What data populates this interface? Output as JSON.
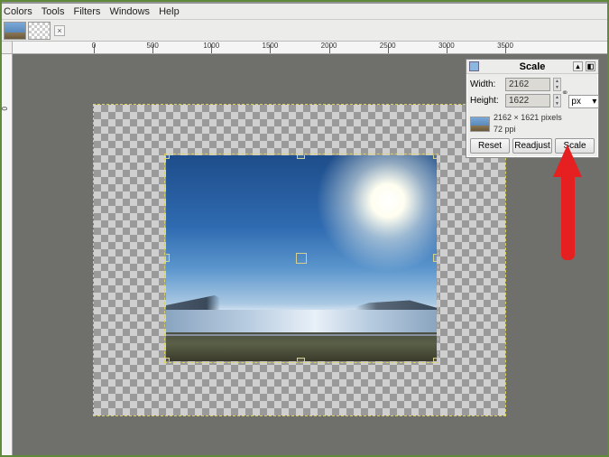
{
  "menubar": [
    "Colors",
    "Tools",
    "Filters",
    "Windows",
    "Help"
  ],
  "ruler_h": [
    0,
    500,
    1000,
    1500,
    2000,
    2500,
    3000,
    3500
  ],
  "ruler_v_zero": "0",
  "dialog": {
    "title": "Scale",
    "width_label": "Width:",
    "height_label": "Height:",
    "width_value": "2162",
    "height_value": "1622",
    "unit": "px",
    "info1": "2162 × 1621 pixels",
    "info2": "72 ppi",
    "reset": "Reset",
    "readjust": "Readjust",
    "scale": "Scale"
  }
}
